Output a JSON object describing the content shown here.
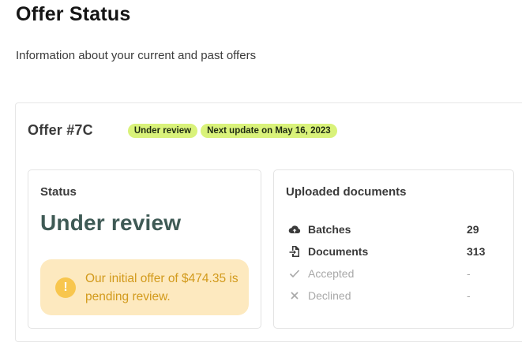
{
  "header": {
    "title": "Offer Status",
    "subtitle": "Information about your current and past offers"
  },
  "offer": {
    "id_label": "Offer #7C",
    "badges": [
      "Under review",
      "Next update on May 16, 2023"
    ]
  },
  "status_panel": {
    "title": "Status",
    "value": "Under review",
    "alert_icon": "!",
    "alert_text": "Our initial offer of $474.35 is pending review."
  },
  "docs_panel": {
    "title": "Uploaded documents",
    "rows": [
      {
        "icon": "cloud-upload-icon",
        "label": "Batches",
        "value": "29"
      },
      {
        "icon": "document-import-icon",
        "label": "Documents",
        "value": "313"
      },
      {
        "icon": "check-icon",
        "label": "Accepted",
        "value": "-"
      },
      {
        "icon": "x-icon",
        "label": "Declined",
        "value": "-"
      }
    ]
  },
  "colors": {
    "badge_bg": "#d9f27a",
    "status_value": "#3f5a55",
    "alert_bg": "#fde9bf",
    "alert_text": "#d29a1c",
    "alert_icon": "#f8c64e"
  }
}
